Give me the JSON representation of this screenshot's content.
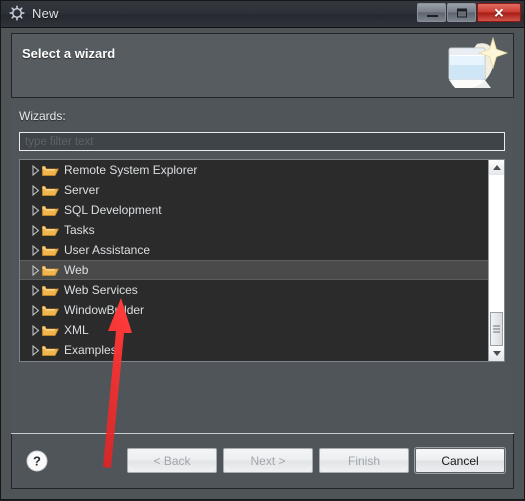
{
  "window": {
    "title": "New",
    "icon": "gear-icon",
    "controls": {
      "minimize": "minimize",
      "maximize": "restore",
      "close": "✕"
    }
  },
  "header": {
    "title": "Select a wizard",
    "art": "wizard-page-sparkle-icon"
  },
  "body": {
    "wizards_label": "Wizards:",
    "filter": {
      "placeholder": "type filter text",
      "value": ""
    },
    "tree": {
      "items": [
        {
          "label": "Remote System Explorer",
          "expanded": false,
          "selected": false
        },
        {
          "label": "Server",
          "expanded": false,
          "selected": false
        },
        {
          "label": "SQL Development",
          "expanded": false,
          "selected": false
        },
        {
          "label": "Tasks",
          "expanded": false,
          "selected": false
        },
        {
          "label": "User Assistance",
          "expanded": false,
          "selected": false
        },
        {
          "label": "Web",
          "expanded": false,
          "selected": true
        },
        {
          "label": "Web Services",
          "expanded": false,
          "selected": false
        },
        {
          "label": "WindowBuilder",
          "expanded": false,
          "selected": false
        },
        {
          "label": "XML",
          "expanded": false,
          "selected": false
        },
        {
          "label": "Examples",
          "expanded": false,
          "selected": false
        }
      ]
    }
  },
  "footer": {
    "help": "?",
    "buttons": [
      {
        "label": "< Back",
        "enabled": false
      },
      {
        "label": "Next >",
        "enabled": false
      },
      {
        "label": "Finish",
        "enabled": false
      },
      {
        "label": "Cancel",
        "enabled": true
      }
    ]
  },
  "annotation": {
    "arrow_color": "#f23030"
  }
}
